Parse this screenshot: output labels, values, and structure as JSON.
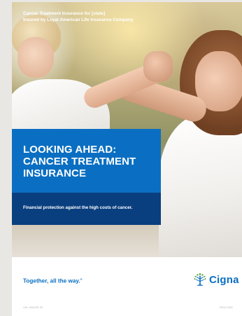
{
  "document": {
    "header_line1": "Cancer Treatment Insurance for [state]",
    "header_line2": "Insured by Loyal American Life Insurance Company",
    "title_line1": "LOOKING AHEAD:",
    "title_line2": "CANCER TREATMENT",
    "title_line3": "INSURANCE",
    "subtitle": "Financial protection against the high costs of cancer.",
    "tagline": "Together, all the way.",
    "tagline_mark": "®",
    "brand_name": "Cigna",
    "footer_code": "LWL-1608-BR-SE",
    "footer_rev": "R6/16 1605"
  },
  "colors": {
    "primary_blue": "#0a6fc2",
    "dark_blue": "#0a3f7f",
    "logo_green": "#5aa13b"
  }
}
